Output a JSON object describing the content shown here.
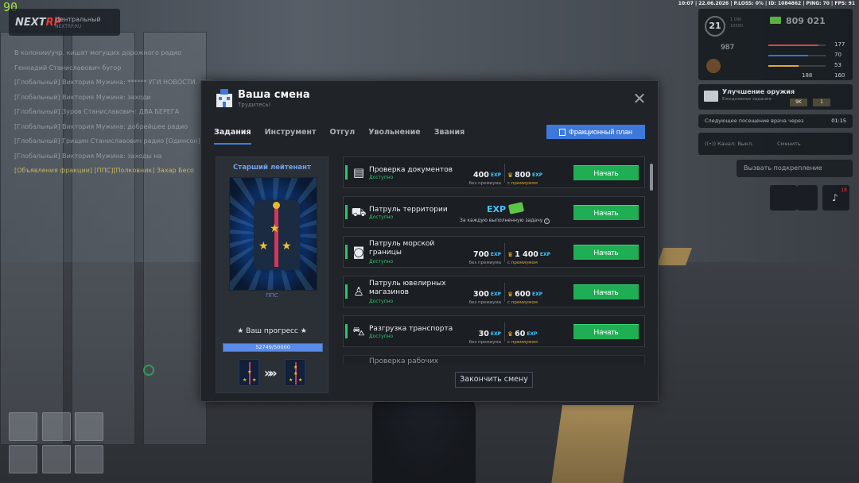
{
  "hud_fps": "90",
  "status_line": "10:07 | 22.06.2026 | P.LOSS: 0% | ID: 1084862 | PING: 70 | FPS: 91",
  "server": {
    "logo_part1": "NEXT",
    "logo_part2": "RP",
    "name": "Центральный",
    "sub": "NEXTRP.RU"
  },
  "chat": [
    {
      "text": "В колонии/учр. кишат могущих дорожного радио",
      "highlight": false
    },
    {
      "text": "Геннадий Станиславович бугор",
      "highlight": false
    },
    {
      "text": "[Глобальный] Виктория Мужина: ****** УГИ НОВОСТИ. ****",
      "highlight": false
    },
    {
      "text": "[Глобальный] Виктория Мужина: заходи",
      "highlight": false
    },
    {
      "text": "[Глобальный] Зуров Станиславович: ДВА БЕРЕГА",
      "highlight": false
    },
    {
      "text": "[Глобальный] Виктория Мужина: добрейшее радио",
      "highlight": false
    },
    {
      "text": "[Глобальный] Грищин Станиславович радио [Одинсон]",
      "highlight": false
    },
    {
      "text": "[Глобальный] Виктория Мужина: заходы на",
      "highlight": false
    },
    {
      "text": "[Объявления фракции] [ППС][Полковник] Захар Бесо",
      "highlight": true
    }
  ],
  "hud": {
    "level": "21",
    "exp_now": "1 090",
    "exp_total": "10500",
    "money": "809 021",
    "armor_value": "987",
    "health": "177",
    "hunger": "70",
    "thirst": "53",
    "fatigue": "188",
    "weight": "160",
    "colors": {
      "health": "#d34848",
      "hunger": "#e2a93a",
      "armor": "#5a8be6",
      "money": "#5caf42"
    }
  },
  "weapon_upgrade": {
    "title": "Улучшение оружия",
    "subtitle": "Ежедневное задание",
    "reward_money": "9K",
    "reward_item": "1"
  },
  "doctor": {
    "label": "Следующее посещение врача через",
    "time": "01:15"
  },
  "radio": {
    "label": "Канал:",
    "value": "Выкл.",
    "switch": "Сменить"
  },
  "backup": {
    "label": "Вызвать подкрепление"
  },
  "square_buttons": {
    "notif_count": "18"
  },
  "panel": {
    "title": "Ваша смена",
    "subtitle": "Трудитесь!",
    "tabs": [
      {
        "label": "Задания",
        "active": true
      },
      {
        "label": "Инструмент",
        "active": false
      },
      {
        "label": "Отгул",
        "active": false
      },
      {
        "label": "Увольнение",
        "active": false
      },
      {
        "label": "Звания",
        "active": false
      }
    ],
    "plan_button": "Фракционный план",
    "finish_button": "Закончить смену"
  },
  "rank": {
    "name": "Старший лейтенант",
    "department": "ППС",
    "progress_title": "★ Ваш прогресс ★",
    "progress_text": "52749/50000",
    "progress_fraction": 1.0
  },
  "tasks": [
    {
      "name": "Проверка документов",
      "status": "Доступно",
      "icon": "documents-icon",
      "base": "400",
      "premium": "800",
      "base_label": "без премиума",
      "premium_label": "с премиумом",
      "button": "Начать"
    },
    {
      "name": "Патруль территории",
      "status": "Доступно",
      "icon": "police-car-icon",
      "special": "За каждую выполненную задачу",
      "button": "Начать"
    },
    {
      "name": "Патруль морской границы",
      "status": "Доступно",
      "icon": "water-icon",
      "base": "700",
      "premium": "1 400",
      "base_label": "без премиума",
      "premium_label": "с премиумом",
      "button": "Начать"
    },
    {
      "name": "Патруль ювелирных магазинов",
      "status": "Доступно",
      "icon": "jewel-icon",
      "base": "300",
      "premium": "600",
      "base_label": "без премиума",
      "premium_label": "с премиумом",
      "button": "Начать"
    },
    {
      "name": "Разгрузка транспорта",
      "status": "Доступно",
      "icon": "forklift-icon",
      "base": "30",
      "premium": "60",
      "base_label": "без премиума",
      "premium_label": "с премиумом",
      "button": "Начать"
    },
    {
      "name": "Проверка рабочих",
      "status": "",
      "icon": "worker-icon"
    }
  ],
  "exp_label": "EXP"
}
